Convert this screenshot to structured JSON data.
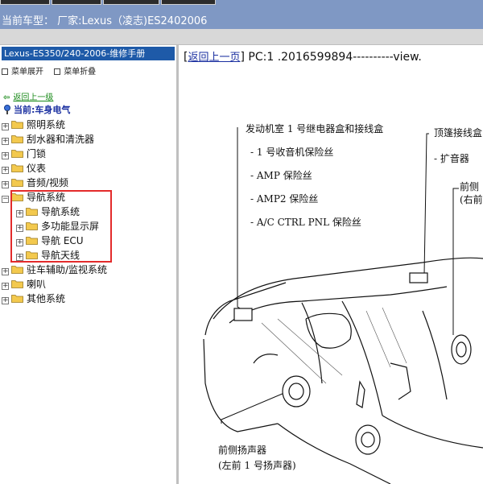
{
  "window": {
    "model_label": "当前车型： 厂家:Lexus（凌志)ES2402006"
  },
  "left_pane": {
    "title": "Lexus-ES350/240-2006-维修手册",
    "expand_label": "菜单展开",
    "collapse_label": "菜单折叠",
    "back_label": "返回上一级",
    "current_label": "当前:车身电气",
    "tree": [
      {
        "label": "照明系统",
        "expanded": false
      },
      {
        "label": "刮水器和清洗器",
        "expanded": false
      },
      {
        "label": "门锁",
        "expanded": false
      },
      {
        "label": "仪表",
        "expanded": false
      },
      {
        "label": "音频/视频",
        "expanded": false
      },
      {
        "label": "导航系统",
        "expanded": true,
        "children": [
          {
            "label": "导航系统"
          },
          {
            "label": "多功能显示屏"
          },
          {
            "label": "导航 ECU"
          },
          {
            "label": "导航天线"
          }
        ]
      },
      {
        "label": "驻车辅助/监视系统",
        "expanded": false
      },
      {
        "label": "喇叭",
        "expanded": false
      },
      {
        "label": "其他系统",
        "expanded": false
      }
    ],
    "highlight_color": "#e32b2b"
  },
  "right_pane": {
    "back_link": "返回上一页",
    "page_info": "PC:1 .2016599894----------view.",
    "diagram": {
      "callout_main": "发动机室 1 号继电器盒和接线盒",
      "items": [
        "- 1 号收音机保险丝",
        "- AMP 保险丝",
        "- AMP2 保险丝",
        "- A/C CTRL PNL 保险丝"
      ],
      "callout_top_right": "顶篷接线盒",
      "top_right_item": "- 扩音器",
      "callout_front_right_1": "前侧",
      "callout_front_right_2": "(右前",
      "callout_bottom_left_1": "前侧扬声器",
      "callout_bottom_left_2": "(左前 1 号扬声器)"
    }
  },
  "colors": {
    "title_bar": "#7f98c4",
    "tree_title_bg": "#1e5aa8",
    "folder": "#f3c94e",
    "link_green": "#1a8a1a",
    "link_blue": "#1a2fa0"
  }
}
